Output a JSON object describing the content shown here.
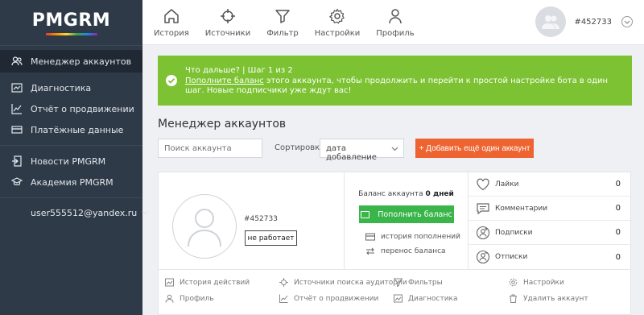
{
  "logo": {
    "text": "PMGRM"
  },
  "sidebar": {
    "items": [
      {
        "label": "Менеджер аккаунтов",
        "icon": "users-icon",
        "active": true
      },
      {
        "label": "Диагностика",
        "icon": "chart-box-icon"
      },
      {
        "label": "Отчёт о продвижении",
        "icon": "trend-icon"
      },
      {
        "label": "Платёжные данные",
        "icon": "card-icon"
      },
      {
        "label": "Новости PMGRM",
        "icon": "news-icon"
      },
      {
        "label": "Академия PMGRM",
        "icon": "graduation-icon"
      }
    ],
    "user_email": "user555512@yandex.ru"
  },
  "topnav": [
    {
      "label": "История",
      "icon": "home-icon"
    },
    {
      "label": "Источники",
      "icon": "crosshair-icon"
    },
    {
      "label": "Фильтр",
      "icon": "filter-icon"
    },
    {
      "label": "Настройки",
      "icon": "gear-icon"
    },
    {
      "label": "Профиль",
      "icon": "person-icon"
    }
  ],
  "profile": {
    "id": "#452733"
  },
  "alert": {
    "heading": "Что дальше? | Шаг 1 из 2",
    "link": "Пополните баланс",
    "text": " этого аккаунта, чтобы продолжить и перейти к простой настройке бота в один шаг. Новые подписчики уже ждут вас!",
    "color": "#7cc232"
  },
  "manager": {
    "title": "Менеджер аккаунтов",
    "search_placeholder": "Поиск аккаунта",
    "sort_label": "Сортировка",
    "sort_value": "дата добавление",
    "add_button": "+ Добавить ещё один аккаунт"
  },
  "account": {
    "id": "#452733",
    "status": "не работает",
    "balance_label": "Баланс аккаунта ",
    "balance_value": "0 дней",
    "topup_button": "Пополнить баланс",
    "history_link": "история пополнений",
    "transfer_link": "перенос баланса",
    "stats": [
      {
        "label": "Лайки",
        "value": "0",
        "icon": "heart-icon"
      },
      {
        "label": "Комментарии",
        "value": "0",
        "icon": "comment-icon"
      },
      {
        "label": "Подписки",
        "value": "0",
        "icon": "user-plus-icon"
      },
      {
        "label": "Отписки",
        "value": "0",
        "icon": "user-minus-icon"
      }
    ],
    "links": {
      "history": "История действий",
      "sources": "Источники поиска аудитории",
      "filters": "Фильтры",
      "settings": "Настройки",
      "profile": "Профиль",
      "report": "Отчёт о продвижении",
      "diagnostics": "Диагностика",
      "delete": "Удалить аккаунт"
    }
  }
}
